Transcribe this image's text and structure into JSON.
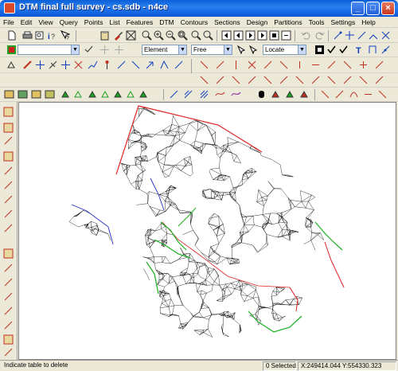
{
  "window": {
    "title": "DTM final full survey - cs.sdb - n4ce",
    "minimize_label": "_",
    "maximize_label": "□",
    "close_label": "×"
  },
  "menu": [
    "File",
    "Edit",
    "View",
    "Query",
    "Points",
    "List",
    "Features",
    "DTM",
    "Contours",
    "Sections",
    "Design",
    "Partitions",
    "Tools",
    "Settings",
    "Help"
  ],
  "toolbar": {
    "layer_combo_value": "",
    "element_combo_value": "Element",
    "mode_combo_value": "Free",
    "snap_combo_value": "Locate"
  },
  "status": {
    "message": "Indicate table to delete",
    "selection": "0 Selected",
    "coordinates": "X:249414.044  Y:554330.323"
  },
  "colors": {
    "boundary": "#e02020",
    "breakline_blue": "#2030c0",
    "breakline_green": "#18b020",
    "mesh": "#000000"
  }
}
